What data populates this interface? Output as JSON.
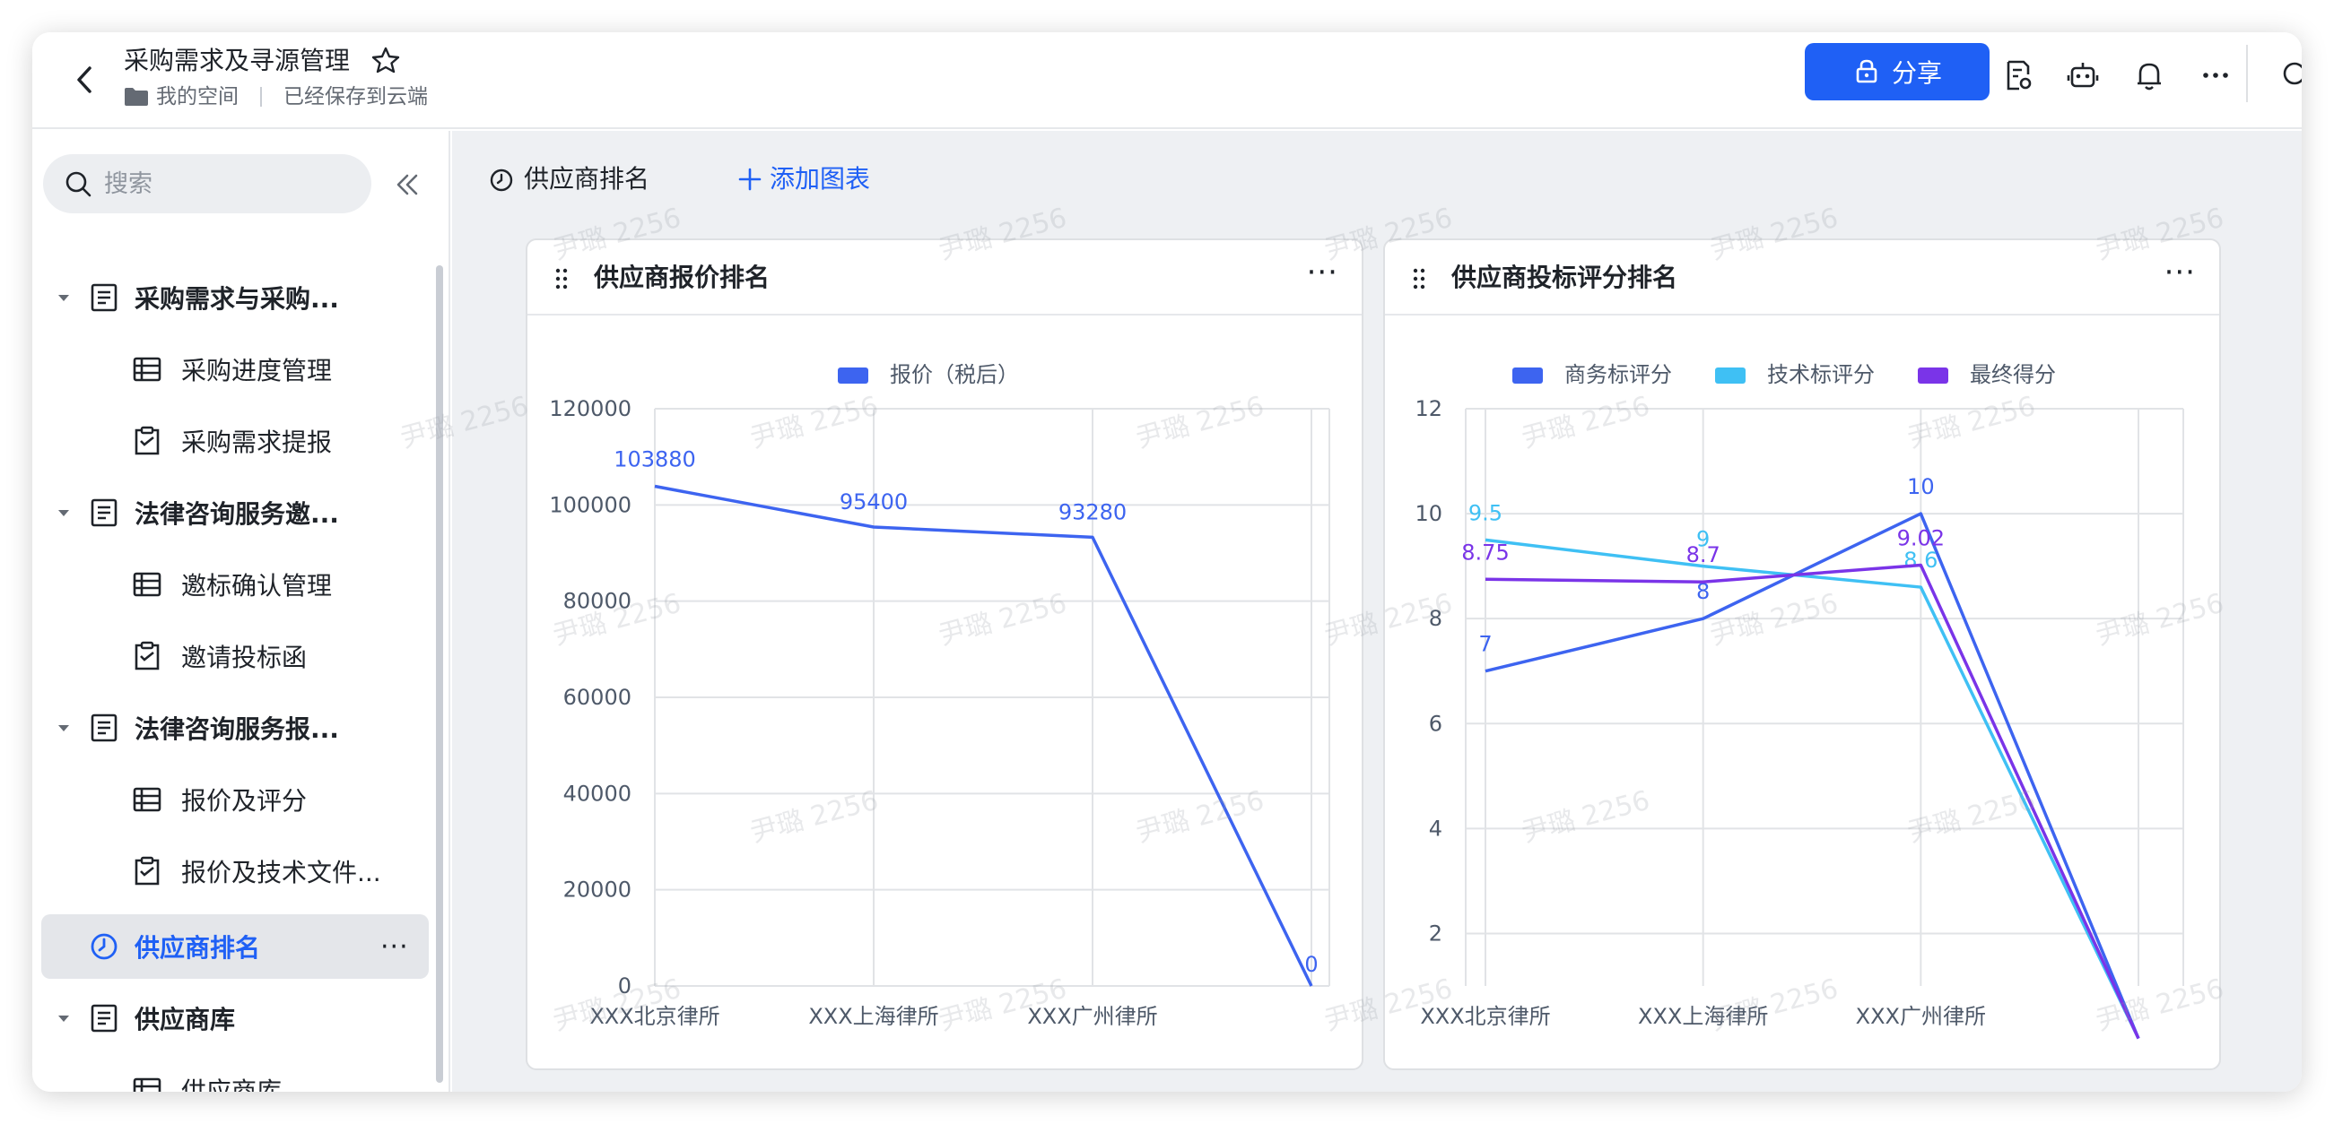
{
  "header": {
    "title": "采购需求及寻源管理",
    "space": "我的空间",
    "save_status": "已经保存到云端",
    "share_label": "分享"
  },
  "sidebar": {
    "search_placeholder": "搜索",
    "items": [
      {
        "label": "采购需求与采购...",
        "type": "group"
      },
      {
        "label": "采购进度管理",
        "type": "table"
      },
      {
        "label": "采购需求提报",
        "type": "form"
      },
      {
        "label": "法律咨询服务邀...",
        "type": "group"
      },
      {
        "label": "邀标确认管理",
        "type": "table"
      },
      {
        "label": "邀请投标函",
        "type": "form"
      },
      {
        "label": "法律咨询服务报...",
        "type": "group"
      },
      {
        "label": "报价及评分",
        "type": "table"
      },
      {
        "label": "报价及技术文件...",
        "type": "form"
      },
      {
        "label": "供应商排名",
        "type": "dashboard",
        "active": true
      },
      {
        "label": "供应商库",
        "type": "group"
      },
      {
        "label": "供应商库",
        "type": "table"
      }
    ]
  },
  "main": {
    "dashboard_title": "供应商排名",
    "add_chart_label": "添加图表",
    "watermark": "尹璐 2256"
  },
  "chart_data": [
    {
      "type": "line",
      "title": "供应商报价排名",
      "categories": [
        "XXX北京律所",
        "XXX上海律所",
        "XXX广州律所",
        ""
      ],
      "series": [
        {
          "name": "报价（税后）",
          "values": [
            103880,
            95400,
            93280,
            0
          ],
          "color": "#3d64f0"
        }
      ],
      "data_labels": [
        "103880",
        "95400",
        "93280",
        "0"
      ],
      "yticks": [
        "0",
        "20000",
        "40000",
        "60000",
        "80000",
        "100000",
        "120000"
      ],
      "ylim": [
        0,
        120000
      ],
      "legend": "top-center",
      "grid": true
    },
    {
      "type": "line",
      "title": "供应商投标评分排名",
      "categories": [
        "XXX北京律所",
        "XXX上海律所",
        "XXX广州律所",
        ""
      ],
      "series": [
        {
          "name": "商务标评分",
          "values": [
            7,
            8,
            10,
            0
          ],
          "color": "#3d64f0",
          "labels": [
            "7",
            "8",
            "10",
            ""
          ]
        },
        {
          "name": "技术标评分",
          "values": [
            9.5,
            9,
            8.6,
            0
          ],
          "color": "#3fc0f4",
          "labels": [
            "9.5",
            "9",
            "8.6",
            ""
          ]
        },
        {
          "name": "最终得分",
          "values": [
            8.75,
            8.7,
            9.02,
            0
          ],
          "color": "#7a34e8",
          "labels": [
            "8.75",
            "8.7",
            "9.02",
            ""
          ]
        }
      ],
      "yticks": [
        "2",
        "4",
        "6",
        "8",
        "10",
        "12"
      ],
      "ylim": [
        1,
        12
      ],
      "legend": "top-center",
      "grid": true
    }
  ]
}
